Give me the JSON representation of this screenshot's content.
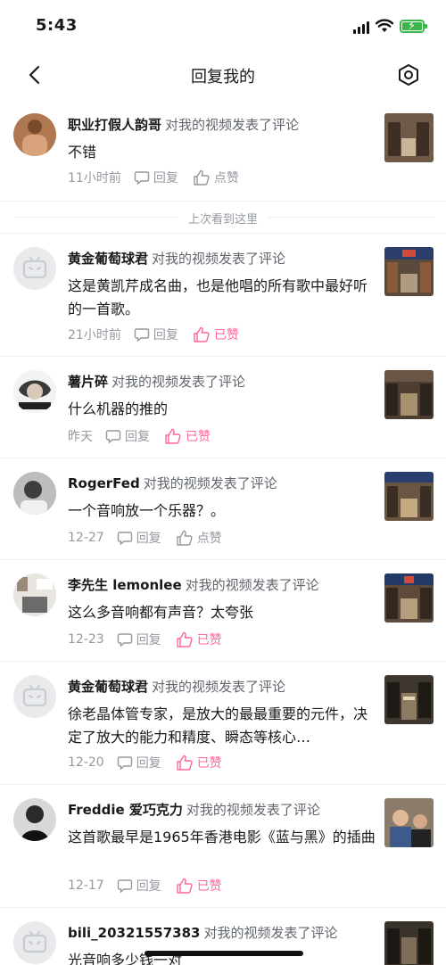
{
  "status_bar": {
    "time": "5:43"
  },
  "header": {
    "title": "回复我的"
  },
  "divider_text": "上次看到这里",
  "labels": {
    "reply": "回复",
    "like": "点赞",
    "liked": "已赞"
  },
  "colors": {
    "accent": "#ff6699",
    "meta": "#9499a0",
    "battery": "#3cb54a"
  },
  "items": [
    {
      "username": "职业打假人韵哥",
      "action": "对我的视频发表了评论",
      "content": "不错",
      "time": "11小时前",
      "liked": false,
      "avatar": "photo-portrait",
      "thumb": "studio-thumbnail"
    },
    {
      "username": "黄金葡萄球君",
      "action": "对我的视频发表了评论",
      "content": "这是黄凯芹成名曲，也是他唱的所有歌中最好听的一首歌。",
      "time": "21小时前",
      "liked": true,
      "avatar": "default-tv-avatar",
      "thumb": "studio-thumbnail"
    },
    {
      "username": "薯片碎",
      "action": "对我的视频发表了评论",
      "content": "什么机器的推的",
      "time": "昨天",
      "liked": true,
      "avatar": "photo-portrait",
      "thumb": "studio-thumbnail"
    },
    {
      "username": "RogerFed",
      "action": "对我的视频发表了评论",
      "content": "一个音响放一个乐器？。",
      "time": "12-27",
      "liked": false,
      "avatar": "photo-portrait",
      "thumb": "studio-thumbnail"
    },
    {
      "username": "李先生 lemonlee",
      "action": "对我的视频发表了评论",
      "content": "这么多音响都有声音？太夸张",
      "time": "12-23",
      "liked": true,
      "avatar": "photo-portrait",
      "thumb": "studio-thumbnail"
    },
    {
      "username": "黄金葡萄球君",
      "action": "对我的视频发表了评论",
      "content": "徐老晶体管专家，是放大的最最重要的元件，决定了放大的能力和精度、瞬态等核心…",
      "time": "12-20",
      "liked": true,
      "avatar": "default-tv-avatar",
      "thumb": "studio-thumbnail"
    },
    {
      "username": "Freddie 爱巧克力",
      "action": "对我的视频发表了评论",
      "content": "这首歌最早是1965年香港电影《蓝与黑》的插曲",
      "time": "12-17",
      "liked": true,
      "avatar": "photo-portrait",
      "thumb": "people-thumbnail"
    },
    {
      "username": "bili_20321557383",
      "action": "对我的视频发表了评论",
      "content": "光音响多少钱一对",
      "time": "",
      "liked": false,
      "avatar": "default-tv-avatar",
      "thumb": "studio-thumbnail"
    }
  ]
}
